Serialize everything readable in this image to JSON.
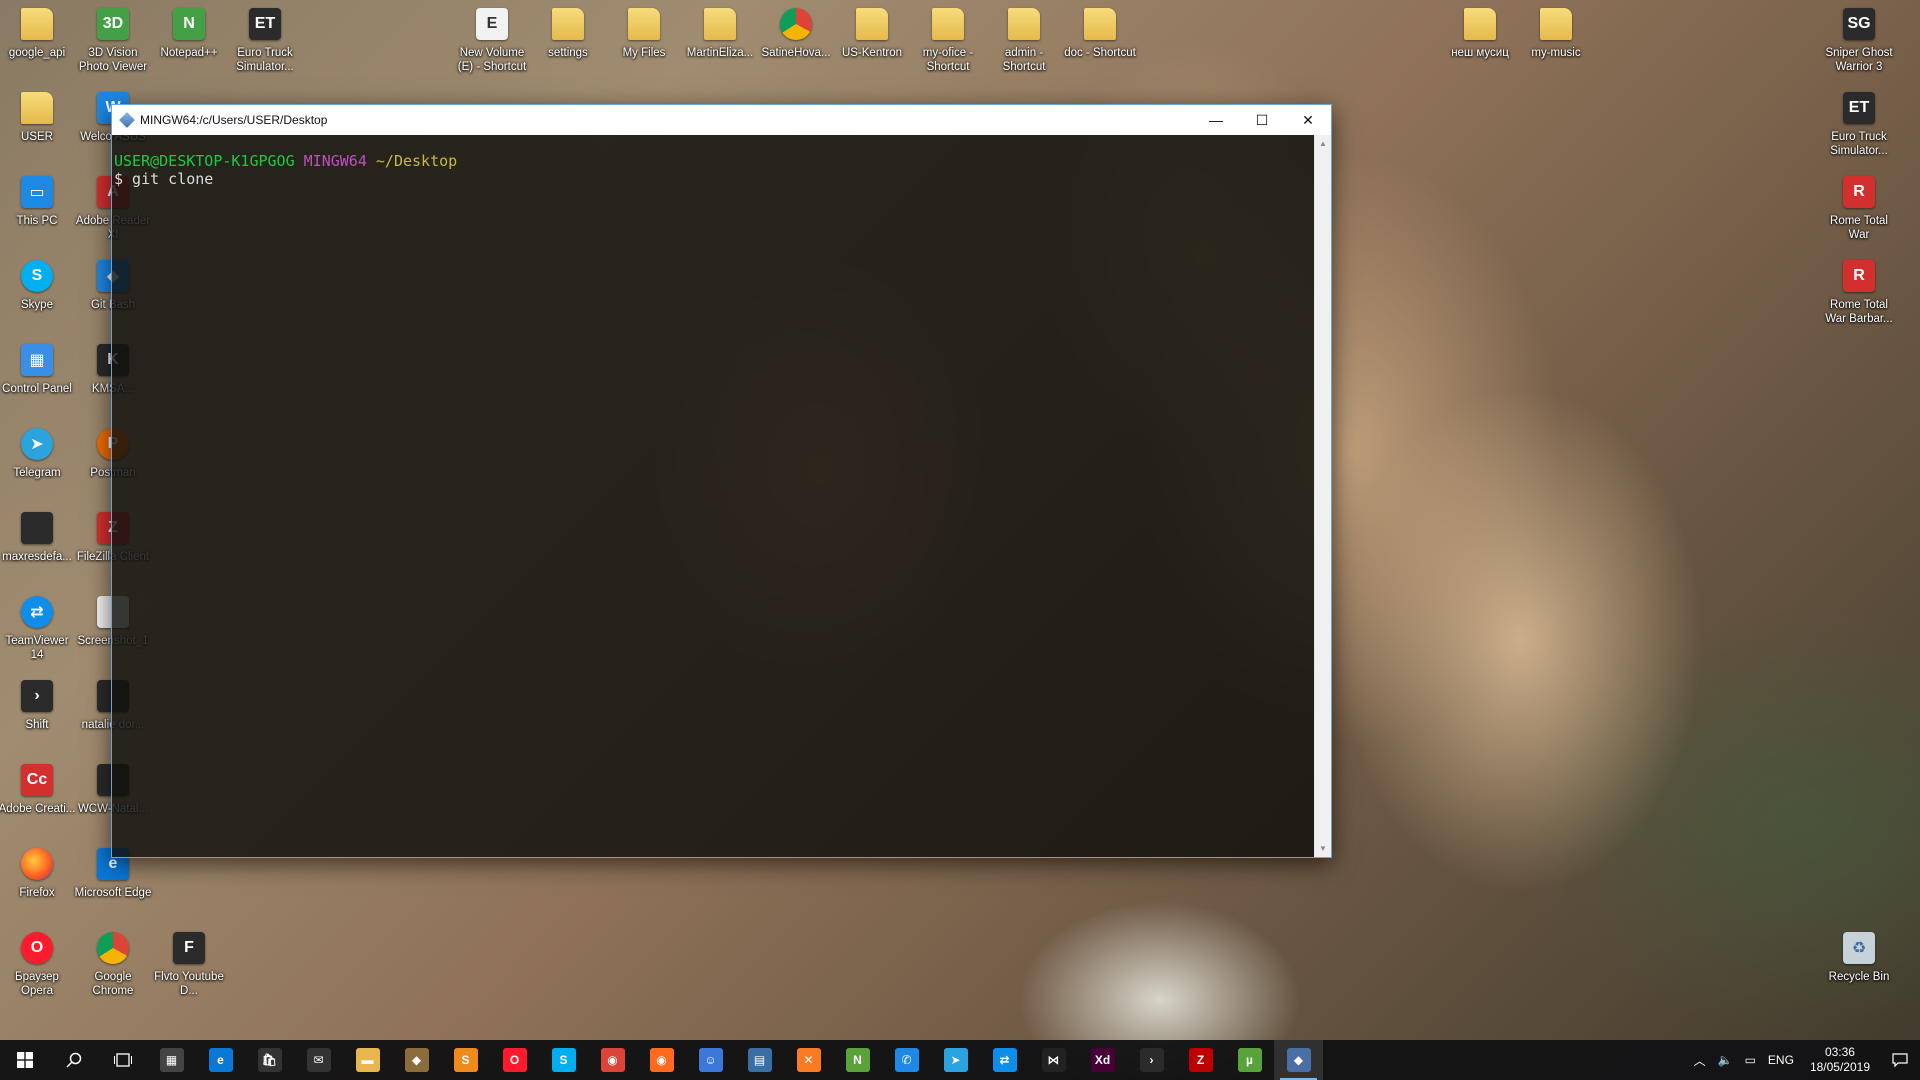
{
  "desktop": {
    "icons": [
      {
        "label": "google_api",
        "style": "folder",
        "glyph": ""
      },
      {
        "label": "3D Vision Photo Viewer",
        "style": "green",
        "glyph": "3D"
      },
      {
        "label": "Notepad++",
        "style": "green",
        "glyph": "N"
      },
      {
        "label": "Euro Truck Simulator...",
        "style": "dark",
        "glyph": "ET"
      },
      {
        "label": "New Volume (E) - Shortcut",
        "style": "doc",
        "glyph": "E"
      },
      {
        "label": "settings",
        "style": "folder",
        "glyph": ""
      },
      {
        "label": "My Files",
        "style": "folder",
        "glyph": ""
      },
      {
        "label": "MartinEliza...",
        "style": "folder",
        "glyph": ""
      },
      {
        "label": "SatineHova...",
        "style": "chrome",
        "glyph": ""
      },
      {
        "label": "US-Kentron",
        "style": "folder",
        "glyph": ""
      },
      {
        "label": "my-ofice - Shortcut",
        "style": "folder",
        "glyph": ""
      },
      {
        "label": "admin - Shortcut",
        "style": "folder",
        "glyph": ""
      },
      {
        "label": "doc - Shortcut",
        "style": "folder",
        "glyph": ""
      },
      {
        "label": "неш мусиц",
        "style": "folder",
        "glyph": ""
      },
      {
        "label": "my-music",
        "style": "folder",
        "glyph": ""
      },
      {
        "label": "Sniper Ghost Warrior 3",
        "style": "dark",
        "glyph": "SG"
      },
      {
        "label": "USER",
        "style": "folder",
        "glyph": ""
      },
      {
        "label": "Welco ASUS",
        "style": "blue",
        "glyph": "W"
      },
      {
        "label": "Euro Truck Simulator...",
        "style": "dark",
        "glyph": "ET"
      },
      {
        "label": "This PC",
        "style": "blue",
        "glyph": "▭"
      },
      {
        "label": "Adobe Reader XI",
        "style": "red",
        "glyph": "A"
      },
      {
        "label": "Rome Total War",
        "style": "red",
        "glyph": "R"
      },
      {
        "label": "Skype",
        "style": "sky",
        "glyph": "S"
      },
      {
        "label": "Git Bash",
        "style": "blue",
        "glyph": "◆"
      },
      {
        "label": "Rome Total War Barbar...",
        "style": "red",
        "glyph": "R"
      },
      {
        "label": "Control Panel",
        "style": "cp",
        "glyph": "▦"
      },
      {
        "label": "KMSA...",
        "style": "dark",
        "glyph": "K"
      },
      {
        "label": "Telegram",
        "style": "tg",
        "glyph": "➤"
      },
      {
        "label": "Postman",
        "style": "orange",
        "glyph": "P"
      },
      {
        "label": "maxresdefa...",
        "style": "dark",
        "glyph": ""
      },
      {
        "label": "FileZilla Client",
        "style": "red",
        "glyph": "Z"
      },
      {
        "label": "TeamViewer 14",
        "style": "tv",
        "glyph": "⇄"
      },
      {
        "label": "Screenshot_1",
        "style": "doc",
        "glyph": ""
      },
      {
        "label": "Shift",
        "style": "dark",
        "glyph": "›"
      },
      {
        "label": "natalie dor...",
        "style": "dark",
        "glyph": ""
      },
      {
        "label": "Adobe Creati...",
        "style": "red",
        "glyph": "Cc"
      },
      {
        "label": "WCW-Natal...",
        "style": "dark",
        "glyph": ""
      },
      {
        "label": "Firefox",
        "style": "ff",
        "glyph": ""
      },
      {
        "label": "Microsoft Edge",
        "style": "edge",
        "glyph": "e"
      },
      {
        "label": "Браузер Opera",
        "style": "opera",
        "glyph": "O"
      },
      {
        "label": "Google Chrome",
        "style": "chrome",
        "glyph": ""
      },
      {
        "label": "Flvto Youtube D...",
        "style": "dark",
        "glyph": "F"
      },
      {
        "label": "Recycle Bin",
        "style": "bin",
        "glyph": "♻"
      }
    ]
  },
  "terminal": {
    "title": "MINGW64:/c/Users/USER/Desktop",
    "prompt_user": "USER@DESKTOP-K1GPGOG",
    "prompt_env": "MINGW64",
    "prompt_path": "~/Desktop",
    "command_line": "$ git clone",
    "minimize": "—",
    "maximize": "☐",
    "close": "✕"
  },
  "taskbar": {
    "apps": [
      {
        "name": "calculator",
        "glyph": "▦",
        "color": "#444"
      },
      {
        "name": "edge",
        "glyph": "e",
        "color": "#0a78d7"
      },
      {
        "name": "store",
        "glyph": "🛍",
        "color": "#333"
      },
      {
        "name": "mail",
        "glyph": "✉",
        "color": "#333"
      },
      {
        "name": "file-explorer",
        "glyph": "▬",
        "color": "#e8b64a"
      },
      {
        "name": "git",
        "glyph": "◆",
        "color": "#8a6d3b"
      },
      {
        "name": "sublime",
        "glyph": "S",
        "color": "#f08a1d"
      },
      {
        "name": "opera",
        "glyph": "O",
        "color": "#ff1b2d"
      },
      {
        "name": "skype",
        "glyph": "S",
        "color": "#00aff0"
      },
      {
        "name": "chrome",
        "glyph": "◉",
        "color": "#db4437"
      },
      {
        "name": "firefox",
        "glyph": "◉",
        "color": "#ff6a1f"
      },
      {
        "name": "app-blue",
        "glyph": "☺",
        "color": "#3c78d8"
      },
      {
        "name": "network-app",
        "glyph": "▤",
        "color": "#3a6fa5"
      },
      {
        "name": "xampp",
        "glyph": "✕",
        "color": "#fb7a24"
      },
      {
        "name": "notepad-plus",
        "glyph": "N",
        "color": "#5aa33a"
      },
      {
        "name": "messenger",
        "glyph": "✆",
        "color": "#1e88e5"
      },
      {
        "name": "telegram",
        "glyph": "➤",
        "color": "#2aa3df"
      },
      {
        "name": "teamviewer",
        "glyph": "⇄",
        "color": "#0e8ee9"
      },
      {
        "name": "bowtie-app",
        "glyph": "⋈",
        "color": "#222"
      },
      {
        "name": "adobe-xd",
        "glyph": "Xd",
        "color": "#470137"
      },
      {
        "name": "shift",
        "glyph": "›",
        "color": "#2b2b2b"
      },
      {
        "name": "filezilla",
        "glyph": "Z",
        "color": "#bf0000"
      },
      {
        "name": "utorrent",
        "glyph": "µ",
        "color": "#5aa33a"
      },
      {
        "name": "git-bash",
        "glyph": "◆",
        "color": "#4a6fa5"
      }
    ],
    "language": "ENG",
    "time": "03:36",
    "date": "18/05/2019"
  }
}
